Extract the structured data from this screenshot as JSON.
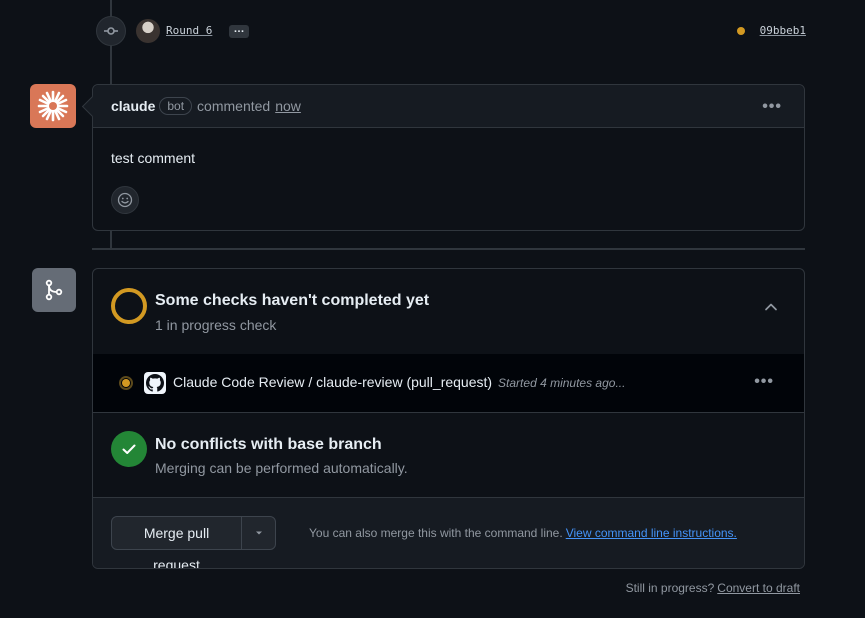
{
  "commit": {
    "message": "Round 6",
    "more": "…",
    "sha": "09bbeb1",
    "status_color": "#d29922"
  },
  "comment": {
    "author": "claude",
    "bot_label": "bot",
    "action": "commented",
    "time": "now",
    "body": "test comment",
    "avatar_color": "#d97757"
  },
  "checks": {
    "title": "Some checks haven't completed yet",
    "subtitle": "1 in progress check",
    "items": [
      {
        "name": "Claude Code Review / claude-review (pull_request)",
        "status": "Started 4 minutes ago..."
      }
    ]
  },
  "conflicts": {
    "title": "No conflicts with base branch",
    "subtitle": "Merging can be performed automatically."
  },
  "merge": {
    "button_label": "Merge pull request",
    "hint": "You can also merge this with the command line.",
    "hint_link": "View command line instructions."
  },
  "draft": {
    "text": "Still in progress?",
    "link": "Convert to draft"
  },
  "colors": {
    "pending": "#d29922",
    "success": "#238636",
    "link": "#4493f8",
    "background": "#0d1117"
  }
}
